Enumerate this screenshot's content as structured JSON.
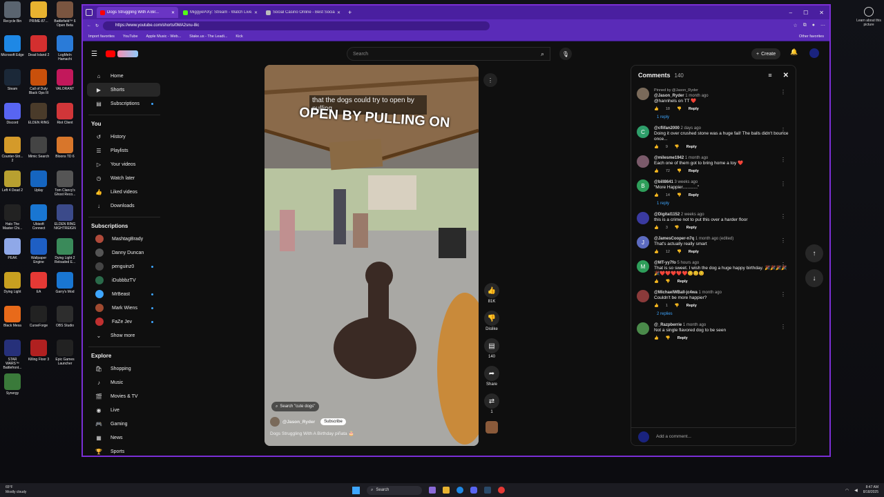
{
  "desktop": {
    "icons": [
      {
        "label": "Recycle Bin",
        "color": "#5a6470"
      },
      {
        "label": "PRIME-87...",
        "color": "#e8b330"
      },
      {
        "label": "Battlefield™ 6 Open Beta",
        "color": "#7a5540"
      },
      {
        "label": "Microsoft Edge",
        "color": "#1e88e5"
      },
      {
        "label": "Dead Island 2",
        "color": "#d32f2f"
      },
      {
        "label": "LogMeIn Hamachi",
        "color": "#2a7bd8"
      },
      {
        "label": "Steam",
        "color": "#1b2838"
      },
      {
        "label": "Call of Duty Black Ops III",
        "color": "#c9500b"
      },
      {
        "label": "VALORANT",
        "color": "#c2185b"
      },
      {
        "label": "Discord",
        "color": "#5865f2"
      },
      {
        "label": "ELDEN RING",
        "color": "#4a3b2a"
      },
      {
        "label": "Riot Client",
        "color": "#d13639"
      },
      {
        "label": "Counter-Stri... 2",
        "color": "#d49a2a"
      },
      {
        "label": "Mimic Search",
        "color": "#444444"
      },
      {
        "label": "Bloons TD 6",
        "color": "#d8762b"
      },
      {
        "label": "Left 4 Dead 2",
        "color": "#b8a030"
      },
      {
        "label": "Uplay",
        "color": "#1565c0"
      },
      {
        "label": "Tom Clancy's Ghost Reco...",
        "color": "#555555"
      },
      {
        "label": "Halo The Master Chi...",
        "color": "#222222"
      },
      {
        "label": "Ubisoft Connect",
        "color": "#1976d2"
      },
      {
        "label": "ELDEN RING NIGHTREIGN",
        "color": "#3b4a8a"
      },
      {
        "label": "PEAK",
        "color": "#8fa8e8"
      },
      {
        "label": "Wallpaper Engine",
        "color": "#1e5fc4"
      },
      {
        "label": "Dying Light 2 Reloaded E...",
        "color": "#3a8a5a"
      },
      {
        "label": "Dying Light",
        "color": "#c8a020"
      },
      {
        "label": "EA",
        "color": "#e53935"
      },
      {
        "label": "Garry's Mod",
        "color": "#1976d2"
      },
      {
        "label": "Black Mesa",
        "color": "#e86a1a"
      },
      {
        "label": "CurseForge",
        "color": "#222222"
      },
      {
        "label": "OBS Studio",
        "color": "#2d2d2d"
      },
      {
        "label": "STAR WARS™ Battlefront...",
        "color": "#26307a"
      },
      {
        "label": "Killing Floor 3",
        "color": "#b02020"
      },
      {
        "label": "Epic Games Launcher",
        "color": "#222222"
      },
      {
        "label": "Synergy",
        "color": "#3a7a3a"
      }
    ],
    "right_note": "Learn about this picture"
  },
  "browser": {
    "tabs": [
      {
        "title": "Dogs Struggling With A Bir...",
        "favicon_color": "#ff0000",
        "active": true
      },
      {
        "title": "MiggyePiXy: Stream - Watch Live...",
        "favicon_color": "#53fc18",
        "active": false
      },
      {
        "title": "Social Casino Online - Best Socia...",
        "favicon_color": "#bbbbbb",
        "active": false
      }
    ],
    "url": "https://www.youtube.com/shorts/0MA2snu-8ic",
    "bookmarks": [
      "Import favorites",
      "YouTube",
      "Apple Music - Web...",
      "Stake.us - The Leadi...",
      "Kick"
    ],
    "other_favorites": "Other favorites"
  },
  "youtube": {
    "search_placeholder": "Search",
    "create_label": "Create",
    "sidebar": {
      "main": [
        {
          "label": "Home",
          "icon": "⌂"
        },
        {
          "label": "Shorts",
          "icon": "▶",
          "active": true
        },
        {
          "label": "Subscriptions",
          "icon": "▤",
          "dot": true
        }
      ],
      "you_header": "You",
      "you": [
        {
          "label": "History",
          "icon": "↺"
        },
        {
          "label": "Playlists",
          "icon": "☰"
        },
        {
          "label": "Your videos",
          "icon": "▷"
        },
        {
          "label": "Watch later",
          "icon": "◷"
        },
        {
          "label": "Liked videos",
          "icon": "👍"
        },
        {
          "label": "Downloads",
          "icon": "↓"
        }
      ],
      "subs_header": "Subscriptions",
      "subs": [
        {
          "label": "MashtagBrady",
          "color": "#b04a3a",
          "dot": false
        },
        {
          "label": "Danny Duncan",
          "color": "#555555",
          "dot": false
        },
        {
          "label": "penguinz0",
          "color": "#444444",
          "dot": true
        },
        {
          "label": "iDubbbzTV",
          "color": "#2a6a4a",
          "dot": false
        },
        {
          "label": "MrBeast",
          "color": "#3ea6ff",
          "dot": true
        },
        {
          "label": "Mark Wiens",
          "color": "#a04a30",
          "dot": true
        },
        {
          "label": "FaZe Jev",
          "color": "#c03030",
          "dot": true
        }
      ],
      "show_more": "Show more",
      "explore_header": "Explore",
      "explore": [
        {
          "label": "Shopping",
          "icon": "🛍"
        },
        {
          "label": "Music",
          "icon": "♪"
        },
        {
          "label": "Movies & TV",
          "icon": "🎬"
        },
        {
          "label": "Live",
          "icon": "◉"
        },
        {
          "label": "Gaming",
          "icon": "🎮"
        },
        {
          "label": "News",
          "icon": "▦"
        },
        {
          "label": "Sports",
          "icon": "🏆"
        }
      ]
    },
    "short": {
      "overlay_caption_small": "that the dogs could try to open by pulling",
      "overlay_caption_big": "OPEN BY PULLING ON",
      "search_chip": "Search \"cute dogs\"",
      "channel": "@Jason_Ryder",
      "subscribe": "Subscribe",
      "title": "Dogs Struggling With A Birthday piñata 🎂"
    },
    "actions": {
      "likes": "81K",
      "dislike": "Dislike",
      "comments": "140",
      "share": "Share",
      "remix": "1"
    },
    "comments": {
      "title": "Comments",
      "count": "140",
      "add_placeholder": "Add a comment...",
      "items": [
        {
          "pinned": "Pinned by @Jason_Ryder",
          "user": "@Jason_Ryder",
          "ago": "1 month ago",
          "text": "@hannhels on TT ❤️",
          "likes": "18",
          "avatar": "#7a6a5a",
          "letter": "",
          "replies": "1 reply"
        },
        {
          "user": "@cflifan2000",
          "ago": "2 days ago",
          "text": "Doing it over crushed stone was a huge fail! The balls didn't bounce once...",
          "likes": "9",
          "avatar": "#2e9e6a",
          "letter": "C",
          "replies": ""
        },
        {
          "user": "@milesme1942",
          "ago": "1 month ago",
          "text": "Each one of them got to bring home a toy ❤️",
          "likes": "72",
          "avatar": "#7a5a6a",
          "letter": "",
          "replies": ""
        },
        {
          "user": "@bill8641",
          "ago": "3 weeks ago",
          "text": "\"More Happier............\"",
          "likes": "14",
          "avatar": "#2e9e5a",
          "letter": "B",
          "replies": "1 reply"
        },
        {
          "user": "@Digital1152",
          "ago": "2 weeks ago",
          "text": "this is a crime not to put this over a harder floor",
          "likes": "3",
          "avatar": "#3a3aa0",
          "letter": "",
          "replies": ""
        },
        {
          "user": "@JamesCooper-n7q",
          "ago": "1 month ago (edited)",
          "text": "That's actually really smart",
          "likes": "12",
          "avatar": "#5c6bc0",
          "letter": "J",
          "replies": ""
        },
        {
          "user": "@MT-yy7fo",
          "ago": "5 hours ago",
          "text": "That is so sweet. I wish the dog a huge happy birthday. 🎉🎉🎉🎉🎉❤️❤️❤️❤️❤️😊😊😊",
          "likes": "",
          "avatar": "#2e9e5a",
          "letter": "M",
          "replies": ""
        },
        {
          "user": "@MichaelWBall-jc4wa",
          "ago": "1 month ago",
          "text": "Couldn't be more happier?",
          "likes": "1",
          "avatar": "#8a3a3a",
          "letter": "",
          "replies": "2 replies"
        },
        {
          "user": "@_Razpberrie",
          "ago": "1 month ago",
          "text": "Not a single flavored dog to be seen",
          "likes": "",
          "avatar": "#4a8a4a",
          "letter": "",
          "replies": ""
        }
      ],
      "reply_label": "Reply"
    }
  },
  "taskbar": {
    "weather_temp": "65°F",
    "weather_desc": "Mostly cloudy",
    "search": "Search",
    "time": "8:47 AM",
    "date": "8/18/2025"
  }
}
